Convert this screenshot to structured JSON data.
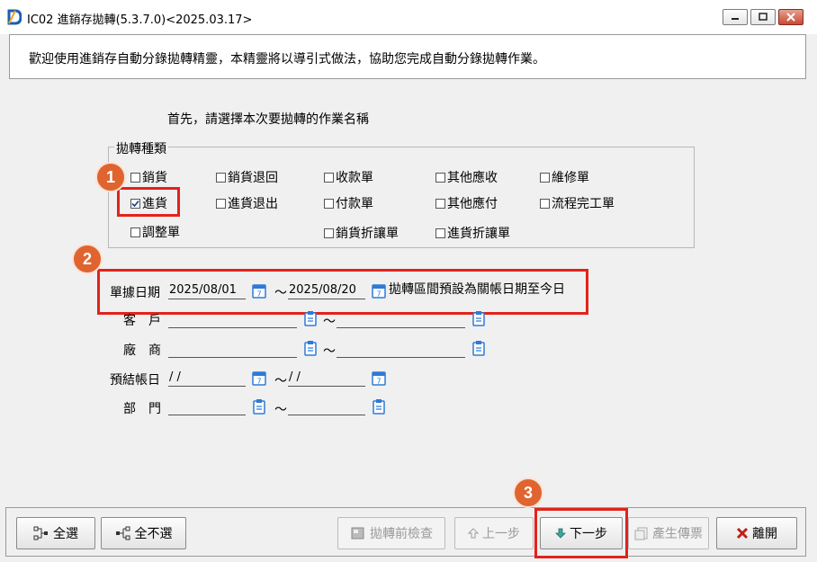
{
  "window": {
    "title": "IC02 進銷存拋轉(5.3.7.0)<2025.03.17>"
  },
  "intro": "歡迎使用進銷存自動分錄拋轉精靈，本精靈將以導引式做法，協助您完成自動分錄拋轉作業。",
  "prompt": "首先，請選擇本次要拋轉的作業名稱",
  "group": {
    "legend": "拋轉種類",
    "options": [
      {
        "label": "銷貨",
        "checked": false
      },
      {
        "label": "銷貨退回",
        "checked": false
      },
      {
        "label": "收款單",
        "checked": false
      },
      {
        "label": "其他應收",
        "checked": false
      },
      {
        "label": "維修單",
        "checked": false
      },
      {
        "label": "進貨",
        "checked": true
      },
      {
        "label": "進貨退出",
        "checked": false
      },
      {
        "label": "付款單",
        "checked": false
      },
      {
        "label": "其他應付",
        "checked": false
      },
      {
        "label": "流程完工單",
        "checked": false
      },
      {
        "label": "調整單",
        "checked": false
      },
      {
        "label": "銷貨折讓單",
        "checked": false
      },
      {
        "label": "進貨折讓單",
        "checked": false
      }
    ]
  },
  "markers": [
    "1",
    "2",
    "3"
  ],
  "form": {
    "doc_date": {
      "label": "單據日期",
      "from": "2025/08/01",
      "to": "2025/08/20",
      "note": "拋轉區間預設為關帳日期至今日"
    },
    "customer": {
      "label": "客　戶",
      "from": "",
      "to": ""
    },
    "vendor": {
      "label": "廠　商",
      "from": "",
      "to": ""
    },
    "close_date": {
      "label": "預結帳日",
      "from": " /  /",
      "to": " /  /"
    },
    "dept": {
      "label": "部　門",
      "from": "",
      "to": ""
    },
    "tilde": "～"
  },
  "buttons": {
    "select_all": "全選",
    "select_none": "全不選",
    "precheck": "拋轉前檢查",
    "prev": "上一步",
    "next": "下一步",
    "generate": "產生傳票",
    "exit": "離開"
  },
  "colors": {
    "accent": "#e2231a",
    "marker": "#e0642f",
    "icon": "#2e7bd6"
  }
}
